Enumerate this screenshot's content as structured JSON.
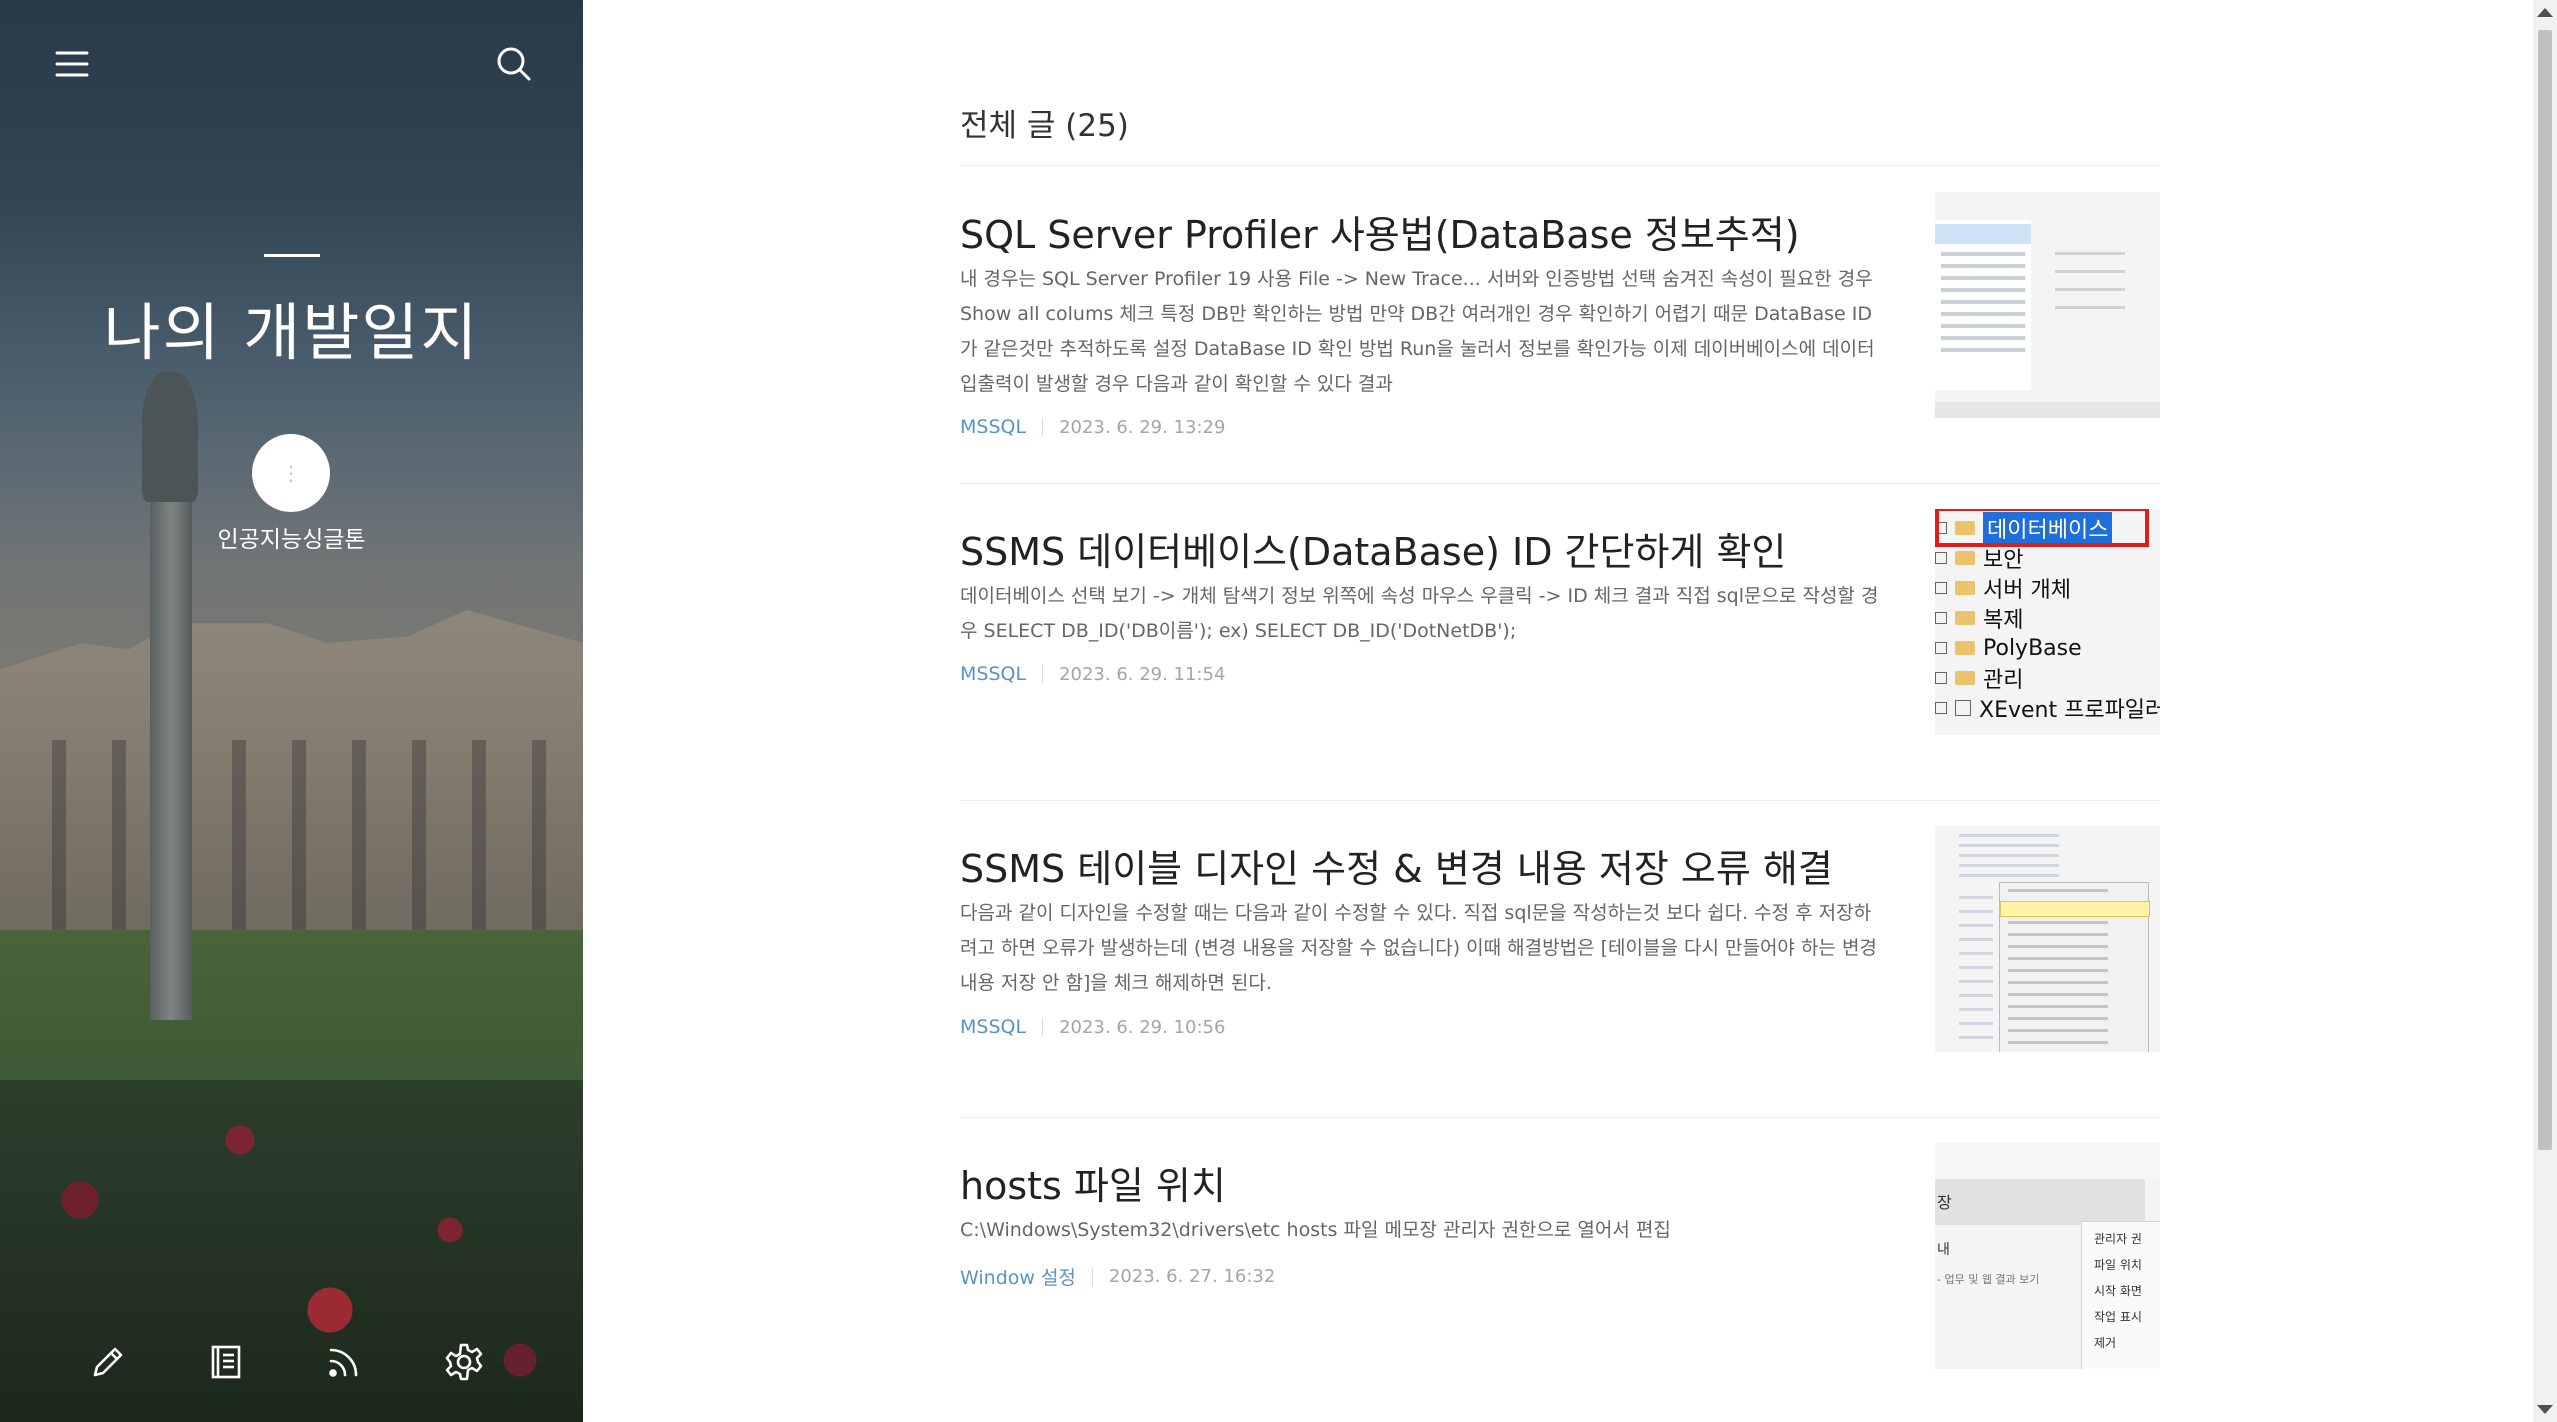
{
  "sidebar": {
    "blog_title": "나의 개발일지",
    "nickname": "인공지능싱글톤",
    "avatar_glyph": "⋮",
    "icons": {
      "menu": "menu-icon",
      "search": "search-icon",
      "write": "pencil-icon",
      "guestbook": "book-icon",
      "rss": "rss-icon",
      "settings": "gear-icon"
    }
  },
  "main": {
    "header_title": "전체 글 (25)",
    "posts": [
      {
        "title": "SQL Server Profiler 사용법(DataBase 정보추적)",
        "excerpt": "내 경우는 SQL Server Profiler 19 사용 File -> New Trace... 서버와 인증방법 선택 숨겨진 속성이 필요한 경우 Show all colums 체크 특정 DB만 확인하는 방법 만약 DB간 여러개인 경우 확인하기 어렵기 때문 DataBase ID가 같은것만 추적하도록 설정 DataBase ID 확인 방법 Run을 눌러서 정보를 확인가능 이제 데이버베이스에 데이터 입출력이 발생할 경우 다음과 같이 확인할 수 있다 결과",
        "category": "MSSQL",
        "date": "2023. 6. 29. 13:29"
      },
      {
        "title": "SSMS 데이터베이스(DataBase) ID 간단하게 확인",
        "excerpt": "데이터베이스 선택 보기 -> 개체 탐색기 정보 위쪽에 속성 마우스 우클릭 -> ID 체크 결과 직접 sql문으로 작성할 경우 SELECT DB_ID('DB이름'); ex) SELECT DB_ID('DotNetDB');",
        "category": "MSSQL",
        "date": "2023. 6. 29. 11:54",
        "thumb_rows": [
          "데이터베이스",
          "보안",
          "서버 개체",
          "복제",
          "PolyBase",
          "관리",
          "XEvent 프로파일러"
        ]
      },
      {
        "title": "SSMS 테이블 디자인 수정 & 변경 내용 저장 오류 해결",
        "excerpt": "다음과 같이 디자인을 수정할 때는 다음과 같이 수정할 수 있다. 직접 sql문을 작성하는것 보다 쉽다. 수정 후 저장하려고 하면 오류가 발생하는데 (변경 내용을 저장할 수 없습니다) 이때 해결방법은 [테이블을 다시 만들어야 하는 변경 내용 저장 안 함]을 체크 해제하면 된다.",
        "category": "MSSQL",
        "date": "2023. 6. 29. 10:56"
      },
      {
        "title": "hosts 파일 위치",
        "excerpt": "C:\\Windows\\System32\\drivers\\etc hosts 파일 메모장 관리자 권한으로 열어서 편집",
        "category": "Window 설정",
        "date": "2023. 6. 27. 16:32",
        "thumb_labels": [
          "장",
          "내",
          "- 업무 및 웹 결과 보기",
          "관리자 권",
          "파일 위치",
          "시작 화면",
          "작업 표시",
          "제거"
        ]
      }
    ]
  }
}
